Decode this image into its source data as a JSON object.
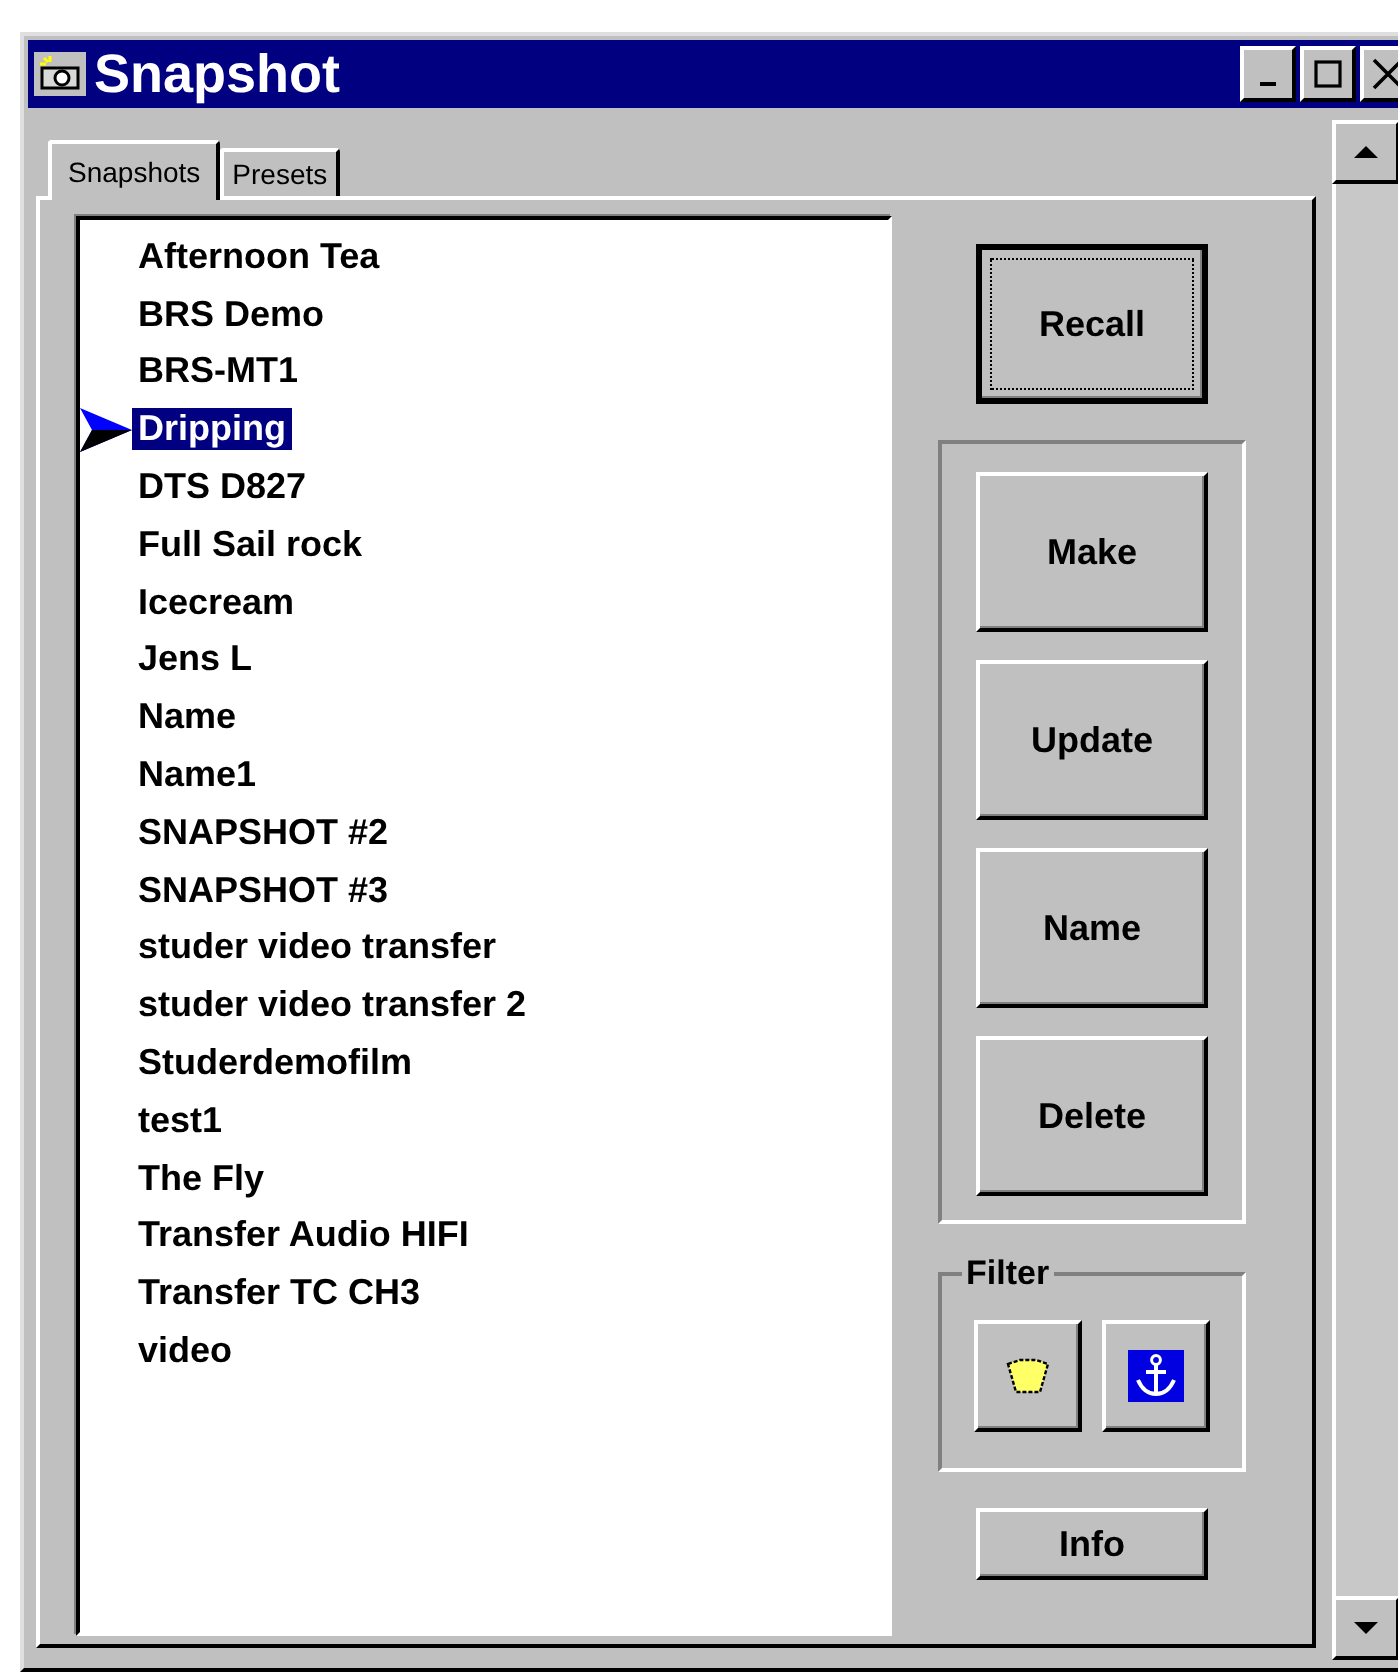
{
  "window": {
    "title": "Snapshot"
  },
  "tabs": [
    {
      "label": "Snapshots",
      "selected": true
    },
    {
      "label": "Presets",
      "selected": false
    }
  ],
  "snapshots": [
    {
      "name": "Afternoon Tea",
      "selected": false
    },
    {
      "name": "BRS Demo",
      "selected": false
    },
    {
      "name": "BRS-MT1",
      "selected": false
    },
    {
      "name": "Dripping",
      "selected": true
    },
    {
      "name": "DTS D827",
      "selected": false
    },
    {
      "name": "Full Sail rock",
      "selected": false
    },
    {
      "name": "Icecream",
      "selected": false
    },
    {
      "name": "Jens L",
      "selected": false
    },
    {
      "name": "Name",
      "selected": false
    },
    {
      "name": "Name1",
      "selected": false
    },
    {
      "name": "SNAPSHOT #2",
      "selected": false
    },
    {
      "name": "SNAPSHOT #3",
      "selected": false
    },
    {
      "name": "studer video transfer",
      "selected": false
    },
    {
      "name": "studer video transfer 2",
      "selected": false
    },
    {
      "name": "Studerdemofilm",
      "selected": false
    },
    {
      "name": "test1",
      "selected": false
    },
    {
      "name": "The Fly",
      "selected": false
    },
    {
      "name": "Transfer Audio HIFI",
      "selected": false
    },
    {
      "name": "Transfer TC CH3",
      "selected": false
    },
    {
      "name": "video",
      "selected": false
    }
  ],
  "recall_button": "Recall",
  "edit_buttons": [
    "Make",
    "Update",
    "Name",
    "Delete"
  ],
  "filter": {
    "label": "Filter",
    "buttons": [
      {
        "kind": "pouch"
      },
      {
        "kind": "anchor"
      }
    ]
  },
  "info_button": "Info"
}
